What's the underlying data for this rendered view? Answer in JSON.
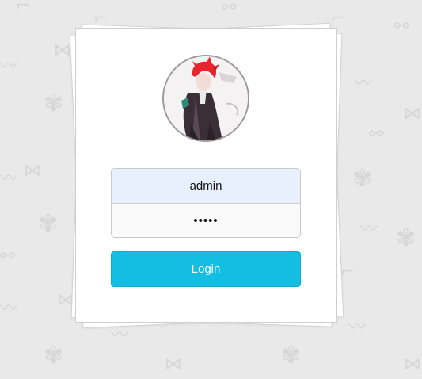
{
  "background": {
    "color": "#e9e9e9",
    "pattern_icon_color": "#d7d7d7",
    "pattern_icons": [
      "leaf-icon",
      "bicycle-icon",
      "bowtie-icon",
      "mustache-icon",
      "pipe-icon"
    ]
  },
  "avatar": {
    "icon": "anime-character-avatar",
    "hair_color": "#e8242e"
  },
  "login_form": {
    "username_value": "admin",
    "password_value": "•••••",
    "login_label": "Login"
  },
  "colors": {
    "button": "#14bde2",
    "username_field_bg": "#e8effd",
    "card": "#ffffff"
  }
}
